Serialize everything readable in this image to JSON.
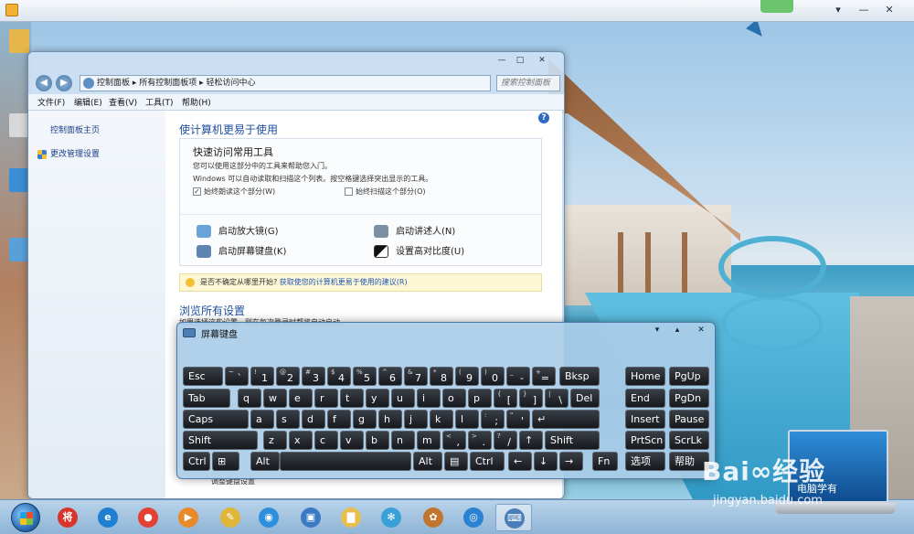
{
  "outer_window": {
    "controls": [
      "▾",
      "—",
      "✕"
    ]
  },
  "control_panel": {
    "nav": {
      "back": "◀",
      "forward": "▶",
      "address": "控制面板 ▸ 所有控制面板项 ▸ 轻松访问中心",
      "search_placeholder": "搜索控制面板"
    },
    "window_controls": [
      "—",
      "□",
      "✕"
    ],
    "menu": [
      "文件(F)",
      "编辑(E)",
      "查看(V)",
      "工具(T)",
      "帮助(H)"
    ],
    "sidebar": {
      "home": "控制面板主页",
      "admin": "更改管理设置"
    },
    "main": {
      "title": "使计算机更易于使用",
      "tools": {
        "heading": "快速访问常用工具",
        "line1": "您可以使用这部分中的工具来帮助您入门。",
        "line2": "Windows 可以自动读取和扫描这个列表。按空格键选择突出显示的工具。",
        "check1": "始终朗读这个部分(W)",
        "check2": "始终扫描这个部分(O)",
        "magnifier": "启动放大镜(G)",
        "narrator": "启动讲述人(N)",
        "osk": "启动屏幕键盘(K)",
        "contrast": "设置高对比度(U)"
      },
      "tip": {
        "prefix": "是否不确定从哪里开始?",
        "link": "获取使您的计算机更易于使用的建议(R)"
      },
      "browse": {
        "title": "浏览所有设置",
        "desc": "如果选择这些设置，则在每次登录时都将自动启动。"
      },
      "bottom_link": "调整键盘设置"
    }
  },
  "osk": {
    "title": "屏幕键盘",
    "controls": [
      "▾",
      "▴",
      "✕"
    ],
    "rows": [
      [
        {
          "k": "esc",
          "t": "Esc"
        },
        {
          "k": "tilde",
          "s": "~",
          "t": "`"
        },
        {
          "k": "1",
          "s": "!",
          "t": "1"
        },
        {
          "k": "2",
          "s": "@",
          "t": "2"
        },
        {
          "k": "3",
          "s": "#",
          "t": "3"
        },
        {
          "k": "4",
          "s": "$",
          "t": "4"
        },
        {
          "k": "5",
          "s": "%",
          "t": "5"
        },
        {
          "k": "6",
          "s": "^",
          "t": "6"
        },
        {
          "k": "7",
          "s": "&",
          "t": "7"
        },
        {
          "k": "8",
          "s": "*",
          "t": "8"
        },
        {
          "k": "9",
          "s": "(",
          "t": "9"
        },
        {
          "k": "0",
          "s": ")",
          "t": "0"
        },
        {
          "k": "minus",
          "s": "_",
          "t": "-"
        },
        {
          "k": "equals",
          "s": "+",
          "t": "="
        },
        {
          "k": "bksp",
          "t": "Bksp"
        },
        {
          "k": "home",
          "t": "Home"
        },
        {
          "k": "pgup",
          "t": "PgUp"
        }
      ],
      [
        {
          "k": "tab",
          "t": "Tab"
        },
        {
          "k": "q",
          "t": "q"
        },
        {
          "k": "w",
          "t": "w"
        },
        {
          "k": "e",
          "t": "e"
        },
        {
          "k": "r",
          "t": "r"
        },
        {
          "k": "t",
          "t": "t"
        },
        {
          "k": "y",
          "t": "y"
        },
        {
          "k": "u",
          "t": "u"
        },
        {
          "k": "i",
          "t": "i"
        },
        {
          "k": "o",
          "t": "o"
        },
        {
          "k": "p",
          "t": "p"
        },
        {
          "k": "lbracket",
          "s": "{",
          "t": "["
        },
        {
          "k": "rbracket",
          "s": "}",
          "t": "]"
        },
        {
          "k": "backslash",
          "s": "|",
          "t": "\\"
        },
        {
          "k": "del",
          "t": "Del"
        },
        {
          "k": "end",
          "t": "End"
        },
        {
          "k": "pgdn",
          "t": "PgDn"
        }
      ],
      [
        {
          "k": "caps",
          "t": "Caps"
        },
        {
          "k": "a",
          "t": "a"
        },
        {
          "k": "s",
          "t": "s"
        },
        {
          "k": "d",
          "t": "d"
        },
        {
          "k": "f",
          "t": "f"
        },
        {
          "k": "g",
          "t": "g"
        },
        {
          "k": "h",
          "t": "h"
        },
        {
          "k": "j",
          "t": "j"
        },
        {
          "k": "k",
          "t": "k"
        },
        {
          "k": "l",
          "t": "l"
        },
        {
          "k": "semicolon",
          "s": ":",
          "t": ";"
        },
        {
          "k": "quote",
          "s": "\"",
          "t": "'"
        },
        {
          "k": "enter",
          "t": "↵"
        },
        {
          "k": "insert",
          "t": "Insert"
        },
        {
          "k": "pause",
          "t": "Pause"
        }
      ],
      [
        {
          "k": "lshift",
          "t": "Shift"
        },
        {
          "k": "z",
          "t": "z"
        },
        {
          "k": "x",
          "t": "x"
        },
        {
          "k": "c",
          "t": "c"
        },
        {
          "k": "v",
          "t": "v"
        },
        {
          "k": "b",
          "t": "b"
        },
        {
          "k": "n",
          "t": "n"
        },
        {
          "k": "m",
          "t": "m"
        },
        {
          "k": "comma",
          "s": "<",
          "t": ","
        },
        {
          "k": "period",
          "s": ">",
          "t": "."
        },
        {
          "k": "slash",
          "s": "?",
          "t": "/"
        },
        {
          "k": "up",
          "t": "↑"
        },
        {
          "k": "rshift",
          "t": "Shift"
        },
        {
          "k": "prtscn",
          "t": "PrtScn"
        },
        {
          "k": "scrlk",
          "t": "ScrLk"
        }
      ],
      [
        {
          "k": "lctrl",
          "t": "Ctrl"
        },
        {
          "k": "win",
          "t": "⊞"
        },
        {
          "k": "lalt",
          "t": "Alt"
        },
        {
          "k": "space",
          "t": ""
        },
        {
          "k": "ralt",
          "t": "Alt"
        },
        {
          "k": "menu",
          "t": "▤"
        },
        {
          "k": "rctrl",
          "t": "Ctrl"
        },
        {
          "k": "left",
          "t": "←"
        },
        {
          "k": "down",
          "t": "↓"
        },
        {
          "k": "right",
          "t": "→"
        },
        {
          "k": "fn",
          "t": "Fn"
        },
        {
          "k": "options",
          "t": "选项"
        },
        {
          "k": "help",
          "t": "帮助"
        }
      ]
    ]
  },
  "taskbar": {
    "items": [
      {
        "name": "jiang-icon",
        "glyph": "将",
        "color": "#d9342b"
      },
      {
        "name": "ie-icon",
        "glyph": "e",
        "color": "#1f7fd1"
      },
      {
        "name": "chrome-icon",
        "glyph": "●",
        "color": "#e34133"
      },
      {
        "name": "media-player-icon",
        "glyph": "▶",
        "color": "#e98a2a"
      },
      {
        "name": "notes-icon",
        "glyph": "✎",
        "color": "#e0b63a"
      },
      {
        "name": "browser-icon",
        "glyph": "◉",
        "color": "#2d8fdc"
      },
      {
        "name": "remote-icon",
        "glyph": "▣",
        "color": "#3a79c4"
      },
      {
        "name": "folder-icon",
        "glyph": "▇",
        "color": "#e7bf4f"
      },
      {
        "name": "pinwheel-icon",
        "glyph": "✻",
        "color": "#3aa0d8"
      },
      {
        "name": "paint-icon",
        "glyph": "✿",
        "color": "#c0762f"
      },
      {
        "name": "ease-access-icon",
        "glyph": "◎",
        "color": "#2b82d1"
      },
      {
        "name": "keyboard-icon",
        "glyph": "⌨",
        "color": "#4a7eb8"
      }
    ]
  },
  "watermark": {
    "brand": "Bai∞经验",
    "url": "jingyan.baidu.com",
    "laptop_text": "电脑学有"
  }
}
